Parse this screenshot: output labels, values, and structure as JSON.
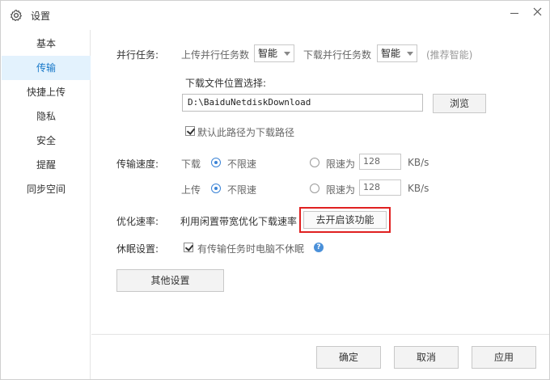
{
  "window": {
    "title": "设置",
    "minimize_icon": "minimize-icon",
    "close_icon": "close-icon"
  },
  "sidebar": {
    "items": [
      {
        "label": "基本",
        "active": false
      },
      {
        "label": "传输",
        "active": true
      },
      {
        "label": "快捷上传",
        "active": false
      },
      {
        "label": "隐私",
        "active": false
      },
      {
        "label": "安全",
        "active": false
      },
      {
        "label": "提醒",
        "active": false
      },
      {
        "label": "同步空间",
        "active": false
      }
    ]
  },
  "parallel": {
    "label": "并行任务:",
    "upload_label": "上传并行任务数",
    "upload_value": "智能",
    "download_label": "下载并行任务数",
    "download_value": "智能",
    "hint": "(推荐智能)"
  },
  "download_location": {
    "label": "下载文件位置选择:",
    "path": "D:\\BaiduNetdiskDownload",
    "browse_button": "浏览",
    "default_checkbox_label": "默认此路径为下载路径",
    "default_checked": true
  },
  "speed": {
    "label": "传输速度:",
    "download": {
      "label": "下载",
      "unlimited_label": "不限速",
      "limited_label": "限速为",
      "limit_value": "128",
      "unit": "KB/s",
      "selected": "unlimited"
    },
    "upload": {
      "label": "上传",
      "unlimited_label": "不限速",
      "limited_label": "限速为",
      "limit_value": "128",
      "unit": "KB/s",
      "selected": "unlimited"
    }
  },
  "optimize": {
    "label": "优化速率:",
    "text": "利用闲置带宽优化下载速率",
    "button": "去开启该功能",
    "highlight_color": "#e02020"
  },
  "sleep": {
    "label": "休眠设置:",
    "checkbox_label": "有传输任务时电脑不休眠",
    "checked": true,
    "help_icon": "help-icon"
  },
  "other_settings_button": "其他设置",
  "footer": {
    "ok": "确定",
    "cancel": "取消",
    "apply": "应用"
  },
  "colors": {
    "accent": "#1677c8",
    "active_bg": "#e3f2fd",
    "help_blue": "#4a90d9"
  }
}
